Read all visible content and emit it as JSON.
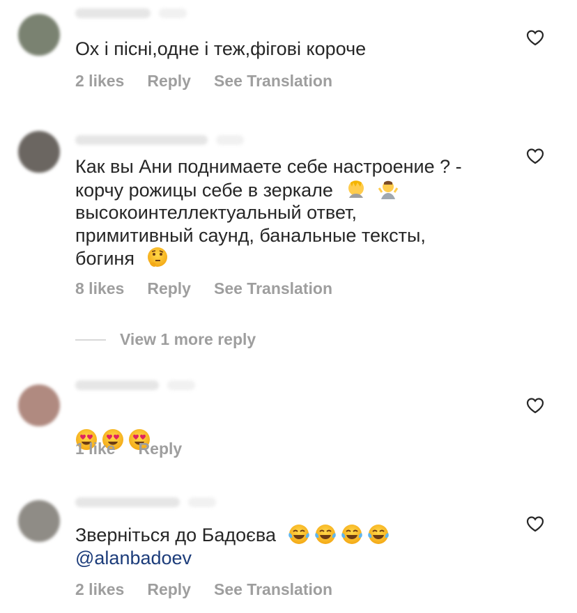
{
  "comments": [
    {
      "text": "Ох і пісні,одне і теж,фігові короче",
      "likes": "2 likes",
      "reply": "Reply",
      "translate": "See Translation",
      "avatar_color": "#7a8271"
    },
    {
      "text_lines": [
        "Как вы Ани поднимаете себе настроение ? -",
        "корчу рожицы себе в зеркале",
        "высокоинтеллектуальный ответ,",
        "примитивный саунд, банальные тексты,",
        "богиня"
      ],
      "likes": "8 likes",
      "reply": "Reply",
      "translate": "See Translation",
      "view_more": "View 1 more reply",
      "avatar_color": "#6b6661"
    },
    {
      "likes": "1 like",
      "reply": "Reply",
      "avatar_color": "#b08a80"
    },
    {
      "text": "Зверніться до Бадоєва",
      "mention": "@alanbadoev",
      "likes": "2 likes",
      "reply": "Reply",
      "translate": "See Translation",
      "avatar_color": "#8f8c86"
    }
  ],
  "icons": {
    "heart": "heart-outline-icon",
    "facepalm": "facepalm-emoji",
    "shrug": "shrug-emoji",
    "thinking": "thinking-face-emoji",
    "heart_eyes": "heart-eyes-emoji",
    "tears_of_joy": "tears-of-joy-emoji"
  }
}
